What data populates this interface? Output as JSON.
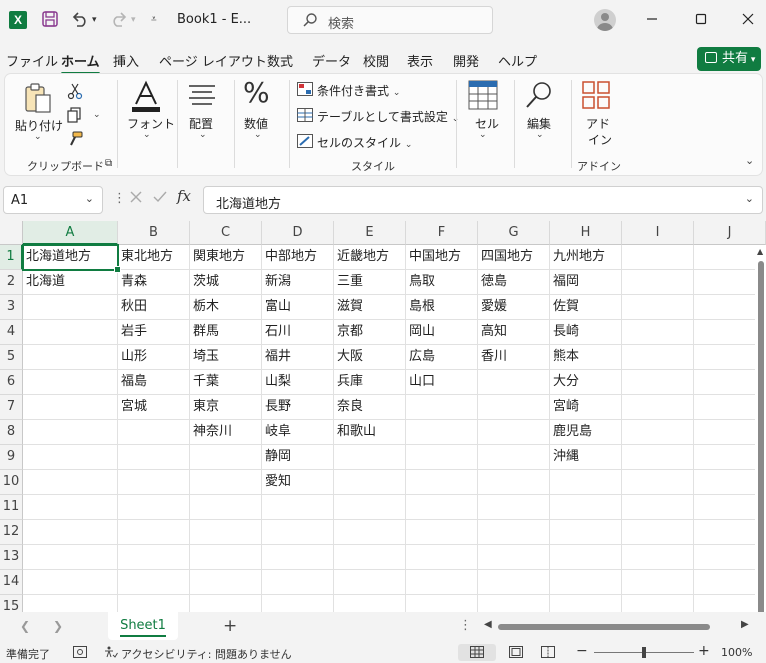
{
  "titlebar": {
    "app_icon": "X",
    "doc_title": "Book1 - E...",
    "search_placeholder": "検索"
  },
  "menu": {
    "tabs": [
      "ファイル",
      "ホーム",
      "挿入",
      "ページ レイアウト",
      "数式",
      "データ",
      "校閲",
      "表示",
      "開発",
      "ヘルプ"
    ],
    "active_tab": "ホーム",
    "share_label": "共有"
  },
  "ribbon": {
    "paste_label": "貼り付け",
    "clipboard_group": "クリップボード",
    "font_label": "フォント",
    "align_label": "配置",
    "number_label": "数値",
    "cond_format": "条件付き書式",
    "table_format": "テーブルとして書式設定",
    "cell_styles": "セルのスタイル",
    "styles_group": "スタイル",
    "cells_label": "セル",
    "edit_label": "編集",
    "addin_label_1": "アド",
    "addin_label_2": "イン",
    "addin_group": "アドイン"
  },
  "formula_bar": {
    "name_box": "A1",
    "formula": "北海道地方",
    "fx": "fx"
  },
  "sheet": {
    "columns": [
      "A",
      "B",
      "C",
      "D",
      "E",
      "F",
      "G",
      "H",
      "I",
      "J"
    ],
    "selected_column": "A",
    "selected_row": 1,
    "rows": [
      [
        "北海道地方",
        "東北地方",
        "関東地方",
        "中部地方",
        "近畿地方",
        "中国地方",
        "四国地方",
        "九州地方",
        "",
        ""
      ],
      [
        "北海道",
        "青森",
        "茨城",
        "新潟",
        "三重",
        "鳥取",
        "徳島",
        "福岡",
        "",
        ""
      ],
      [
        "",
        "秋田",
        "栃木",
        "富山",
        "滋賀",
        "島根",
        "愛媛",
        "佐賀",
        "",
        ""
      ],
      [
        "",
        "岩手",
        "群馬",
        "石川",
        "京都",
        "岡山",
        "高知",
        "長崎",
        "",
        ""
      ],
      [
        "",
        "山形",
        "埼玉",
        "福井",
        "大阪",
        "広島",
        "香川",
        "熊本",
        "",
        ""
      ],
      [
        "",
        "福島",
        "千葉",
        "山梨",
        "兵庫",
        "山口",
        "",
        "大分",
        "",
        ""
      ],
      [
        "",
        "宮城",
        "東京",
        "長野",
        "奈良",
        "",
        "",
        "宮崎",
        "",
        ""
      ],
      [
        "",
        "",
        "神奈川",
        "岐阜",
        "和歌山",
        "",
        "",
        "鹿児島",
        "",
        ""
      ],
      [
        "",
        "",
        "",
        "静岡",
        "",
        "",
        "",
        "沖縄",
        "",
        ""
      ],
      [
        "",
        "",
        "",
        "愛知",
        "",
        "",
        "",
        "",
        "",
        ""
      ],
      [
        "",
        "",
        "",
        "",
        "",
        "",
        "",
        "",
        "",
        ""
      ],
      [
        "",
        "",
        "",
        "",
        "",
        "",
        "",
        "",
        "",
        ""
      ],
      [
        "",
        "",
        "",
        "",
        "",
        "",
        "",
        "",
        "",
        ""
      ],
      [
        "",
        "",
        "",
        "",
        "",
        "",
        "",
        "",
        "",
        ""
      ],
      [
        "",
        "",
        "",
        "",
        "",
        "",
        "",
        "",
        "",
        ""
      ]
    ],
    "row_numbers": [
      "1",
      "2",
      "3",
      "4",
      "5",
      "6",
      "7",
      "8",
      "9",
      "10",
      "11",
      "12",
      "13",
      "14",
      "15"
    ]
  },
  "sheet_tabs": {
    "active": "Sheet1",
    "add": "+"
  },
  "statusbar": {
    "ready": "準備完了",
    "accessibility": "アクセシビリティ: 問題ありません",
    "zoom": "100%",
    "zoom_fraction": 0.5
  },
  "colors": {
    "accent": "#107c41",
    "ribbon_bg": "#fbfbfb",
    "chrome_bg": "#f3f3f3"
  },
  "icons": [
    "excel-logo-icon",
    "save-icon",
    "undo-icon",
    "redo-icon",
    "customize-icon",
    "search-icon",
    "avatar-icon",
    "minimize-icon",
    "maximize-icon",
    "close-icon",
    "share-icon"
  ]
}
